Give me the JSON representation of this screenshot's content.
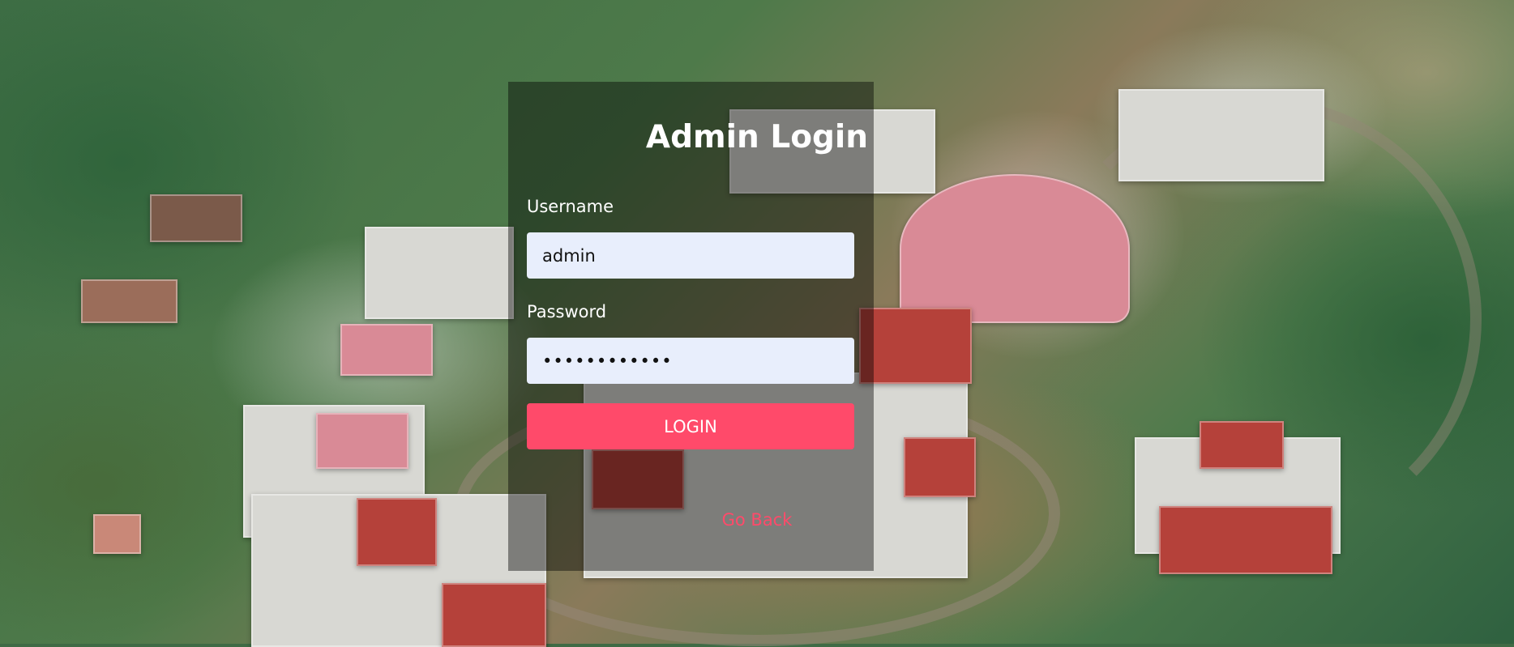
{
  "login": {
    "title": "Admin Login",
    "username_label": "Username",
    "username_value": "admin",
    "password_label": "Password",
    "password_value": "••••••••••••",
    "login_button": "LOGIN",
    "go_back": "Go Back"
  },
  "colors": {
    "accent": "#ff4a6a",
    "input_bg": "#e8eefc",
    "panel_bg": "rgba(0,0,0,0.42)"
  }
}
